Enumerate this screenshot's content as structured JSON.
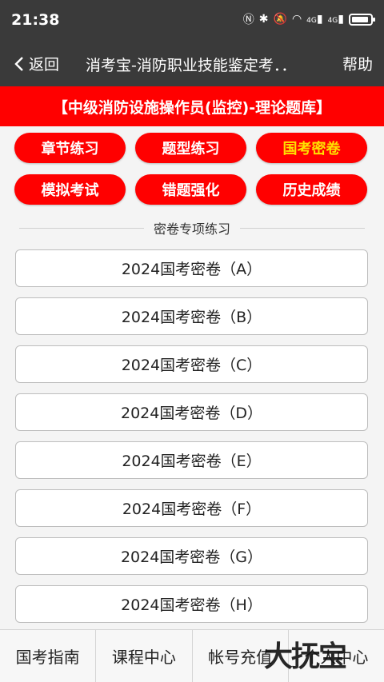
{
  "status": {
    "time": "21:38",
    "net1": "4G",
    "net2": "4G"
  },
  "nav": {
    "back_label": "返回",
    "title": "消考宝-消防职业技能鉴定考．．",
    "help_label": "帮助"
  },
  "banner": {
    "text": "【中级消防设施操作员(监控)-理论题库】"
  },
  "menu": [
    {
      "label": "章节练习"
    },
    {
      "label": "题型练习"
    },
    {
      "label": "国考密卷",
      "active": true
    },
    {
      "label": "模拟考试"
    },
    {
      "label": "错题强化"
    },
    {
      "label": "历史成绩"
    }
  ],
  "section": {
    "label": "密卷专项练习"
  },
  "papers": [
    "2024国考密卷（A）",
    "2024国考密卷（B）",
    "2024国考密卷（C）",
    "2024国考密卷（D）",
    "2024国考密卷（E）",
    "2024国考密卷（F）",
    "2024国考密卷（G）",
    "2024国考密卷（H）"
  ],
  "tabs": [
    "国考指南",
    "课程中心",
    "帐号充值",
    "个人中心"
  ],
  "watermark": "大抚宝",
  "colors": {
    "accent": "#ff0000",
    "active_text": "#ffe100",
    "bar": "#3a3a3a"
  }
}
